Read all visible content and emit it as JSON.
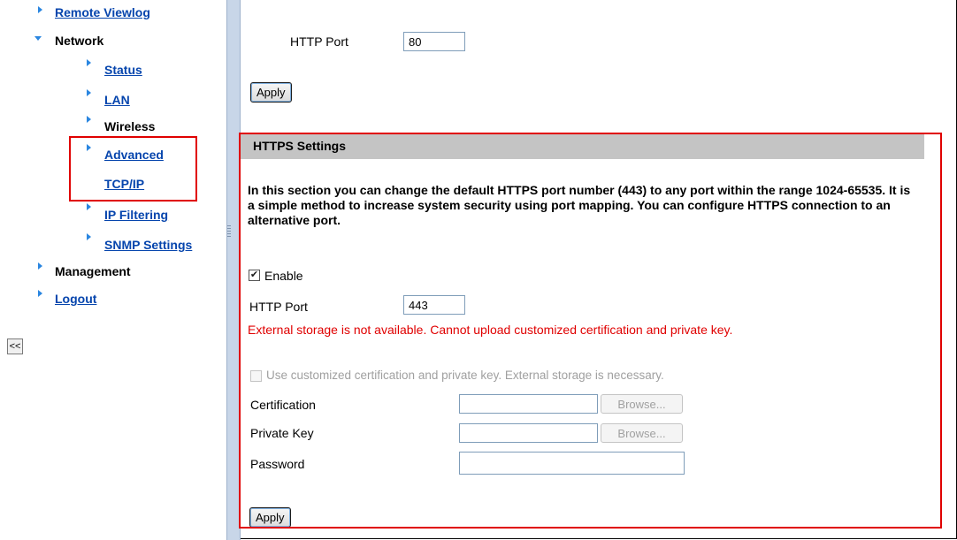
{
  "sidebar": {
    "items": [
      {
        "label": "Remote Viewlog",
        "link": true,
        "arrow": "right"
      },
      {
        "label": "Network",
        "link": false,
        "arrow": "down"
      },
      {
        "label": "Status",
        "link": true,
        "arrow": "right"
      },
      {
        "label": "LAN",
        "link": true,
        "arrow": "right"
      },
      {
        "label": "Wireless",
        "link": false,
        "arrow": "right"
      },
      {
        "label": "Advanced",
        "link": true,
        "arrow": "right"
      },
      {
        "label": "TCP/IP",
        "link": true,
        "arrow": "none"
      },
      {
        "label": "IP Filtering",
        "link": true,
        "arrow": "right"
      },
      {
        "label": "SNMP Settings",
        "link": true,
        "arrow": "right"
      },
      {
        "label": "Management",
        "link": false,
        "arrow": "right"
      },
      {
        "label": "Logout",
        "link": true,
        "arrow": "right"
      }
    ],
    "collapse_label": "<<",
    "arrow_color": "#2a86e0",
    "link_color": "#0645ad"
  },
  "http": {
    "port_label": "HTTP Port",
    "port_value": "80",
    "apply_label": "Apply"
  },
  "https": {
    "header": "HTTPS Settings",
    "description": "In this section you can change the default HTTPS port number (443) to any port within the range 1024-65535. It is a simple method to increase system security using port mapping. You can configure HTTPS connection to an alternative port.",
    "enable_label": "Enable",
    "enable_checked": true,
    "port_label": "HTTP Port",
    "port_value": "443",
    "error": "External storage is not available. Cannot upload customized certification and private key.",
    "custom_cert_label": "Use customized certification and private key. External storage is necessary.",
    "custom_cert_checked": false,
    "certification_label": "Certification",
    "private_key_label": "Private Key",
    "password_label": "Password",
    "browse_label": "Browse...",
    "apply_label": "Apply"
  },
  "colors": {
    "highlight": "#e00000",
    "header_bg": "#c4c4c4",
    "error_text": "#e00000"
  }
}
